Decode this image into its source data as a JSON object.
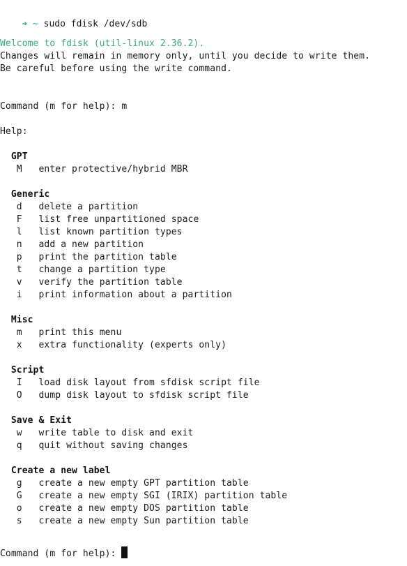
{
  "terminal": {
    "colors": {
      "background": "#ffffff",
      "foreground": "#1a1a1a",
      "prompt_arrow": "#00a96e",
      "prompt_path": "#17a8a0",
      "welcome_green": "#3aa884",
      "cursor": "#111111"
    },
    "prompt": {
      "arrow_glyph": "➔",
      "path": "~",
      "command": "sudo fdisk /dev/sdb"
    },
    "intro": {
      "welcome": "Welcome to fdisk (util-linux 2.36.2).",
      "line2": "Changes will remain in memory only, until you decide to write them.",
      "line3": "Be careful before using the write command."
    },
    "command_prompt_label": "Command (m for help):",
    "entered_command": "m",
    "help_label": "Help:",
    "sections": [
      {
        "title": "GPT",
        "entries": [
          {
            "key": "M",
            "desc": "enter protective/hybrid MBR"
          }
        ]
      },
      {
        "title": "Generic",
        "entries": [
          {
            "key": "d",
            "desc": "delete a partition"
          },
          {
            "key": "F",
            "desc": "list free unpartitioned space"
          },
          {
            "key": "l",
            "desc": "list known partition types"
          },
          {
            "key": "n",
            "desc": "add a new partition"
          },
          {
            "key": "p",
            "desc": "print the partition table"
          },
          {
            "key": "t",
            "desc": "change a partition type"
          },
          {
            "key": "v",
            "desc": "verify the partition table"
          },
          {
            "key": "i",
            "desc": "print information about a partition"
          }
        ]
      },
      {
        "title": "Misc",
        "entries": [
          {
            "key": "m",
            "desc": "print this menu"
          },
          {
            "key": "x",
            "desc": "extra functionality (experts only)"
          }
        ]
      },
      {
        "title": "Script",
        "entries": [
          {
            "key": "I",
            "desc": "load disk layout from sfdisk script file"
          },
          {
            "key": "O",
            "desc": "dump disk layout to sfdisk script file"
          }
        ]
      },
      {
        "title": "Save & Exit",
        "entries": [
          {
            "key": "w",
            "desc": "write table to disk and exit"
          },
          {
            "key": "q",
            "desc": "quit without saving changes"
          }
        ]
      },
      {
        "title": "Create a new label",
        "entries": [
          {
            "key": "g",
            "desc": "create a new empty GPT partition table"
          },
          {
            "key": "G",
            "desc": "create a new empty SGI (IRIX) partition table"
          },
          {
            "key": "o",
            "desc": "create a new empty DOS partition table"
          },
          {
            "key": "s",
            "desc": "create a new empty Sun partition table"
          }
        ]
      }
    ],
    "final_prompt": {
      "label": "Command (m for help): ",
      "cursor": "block-cursor"
    }
  }
}
